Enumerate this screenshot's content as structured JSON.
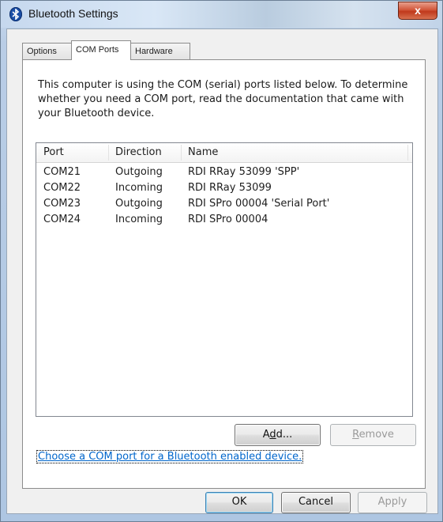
{
  "window": {
    "title": "Bluetooth Settings",
    "close_label": "x"
  },
  "tabs": [
    {
      "label": "Options",
      "active": false
    },
    {
      "label": "COM Ports",
      "active": true
    },
    {
      "label": "Hardware",
      "active": false
    }
  ],
  "com_ports": {
    "description": "This computer is using the COM (serial) ports listed below. To determine whether you need a COM port, read the documentation that came with your Bluetooth device.",
    "columns": [
      "Port",
      "Direction",
      "Name"
    ],
    "rows": [
      {
        "port": "COM21",
        "direction": "Outgoing",
        "name": "RDI RRay 53099 'SPP'"
      },
      {
        "port": "COM22",
        "direction": "Incoming",
        "name": "RDI RRay 53099"
      },
      {
        "port": "COM23",
        "direction": "Outgoing",
        "name": "RDI SPro 00004 'Serial Port'"
      },
      {
        "port": "COM24",
        "direction": "Incoming",
        "name": "RDI SPro 00004"
      }
    ],
    "add_button": {
      "pre": "A",
      "accel": "d",
      "post": "d..."
    },
    "remove_button": {
      "pre": "",
      "accel": "R",
      "post": "emove"
    },
    "link_text": "Choose a COM port for a Bluetooth enabled device."
  },
  "footer": {
    "ok_label": "OK",
    "cancel_label": "Cancel",
    "apply_label": "Apply"
  }
}
